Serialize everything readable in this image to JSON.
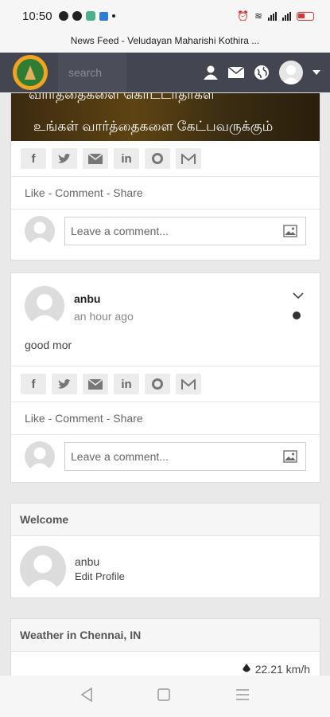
{
  "status_bar": {
    "time": "10:50"
  },
  "url_bar": {
    "title": "News Feed - Veludayan Maharishi Kothira ..."
  },
  "navbar": {
    "search_placeholder": "search"
  },
  "feed": {
    "post1": {
      "banner_line1": "வார்த்தைகளை கொட்டாதர்கள்",
      "banner_line2": "உங்கள் வார்த்தைகளை கேட்பவருக்கும்",
      "actions": "Like - Comment - Share",
      "comment_placeholder": "Leave a comment..."
    },
    "post2": {
      "author": "anbu",
      "time": "an hour ago",
      "text": "good mor",
      "actions": "Like - Comment - Share",
      "comment_placeholder": "Leave a comment..."
    }
  },
  "welcome": {
    "title": "Welcome",
    "name": "anbu",
    "edit_label": "Edit Profile"
  },
  "weather": {
    "title": "Weather in Chennai, IN",
    "wind": "22.21 km/h"
  },
  "share_icons": [
    "facebook-icon",
    "twitter-icon",
    "email-icon",
    "linkedin-icon",
    "whatsapp-icon",
    "gmail-icon"
  ]
}
